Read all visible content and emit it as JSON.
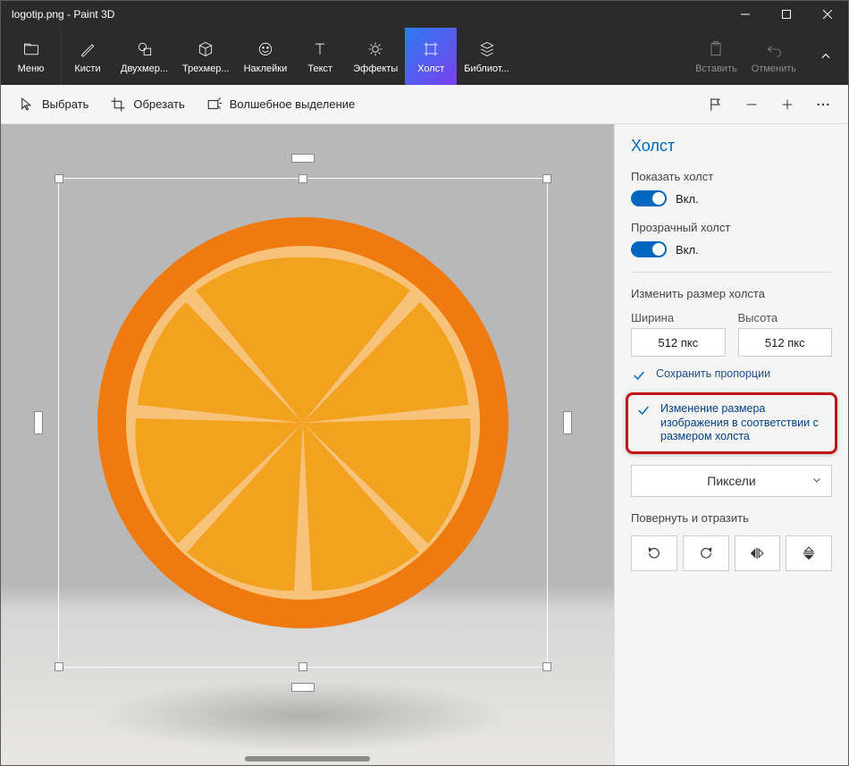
{
  "titlebar": {
    "title": "logotip.png - Paint 3D"
  },
  "ribbon": {
    "menu": "Меню",
    "brushes": "Кисти",
    "shapes2d": "Двухмер...",
    "shapes3d": "Трехмер...",
    "stickers": "Наклейки",
    "text": "Текст",
    "effects": "Эффекты",
    "canvas": "Холст",
    "library": "Библиот...",
    "paste": "Вставить",
    "undo": "Отменить"
  },
  "subbar": {
    "select": "Выбрать",
    "crop": "Обрезать",
    "magic": "Волшебное выделение"
  },
  "side": {
    "title": "Холст",
    "show_canvas_label": "Показать холст",
    "transparent_label": "Прозрачный холст",
    "on": "Вкл.",
    "resize_title": "Изменить размер холста",
    "width_label": "Ширина",
    "height_label": "Высота",
    "width_value": "512 пкс",
    "height_value": "512 пкс",
    "lock_aspect": "Сохранить пропорции",
    "resize_image_with_canvas": "Изменение размера изображения в соответствии с размером холста",
    "units": "Пиксели",
    "rotate_title": "Повернуть и отразить"
  }
}
